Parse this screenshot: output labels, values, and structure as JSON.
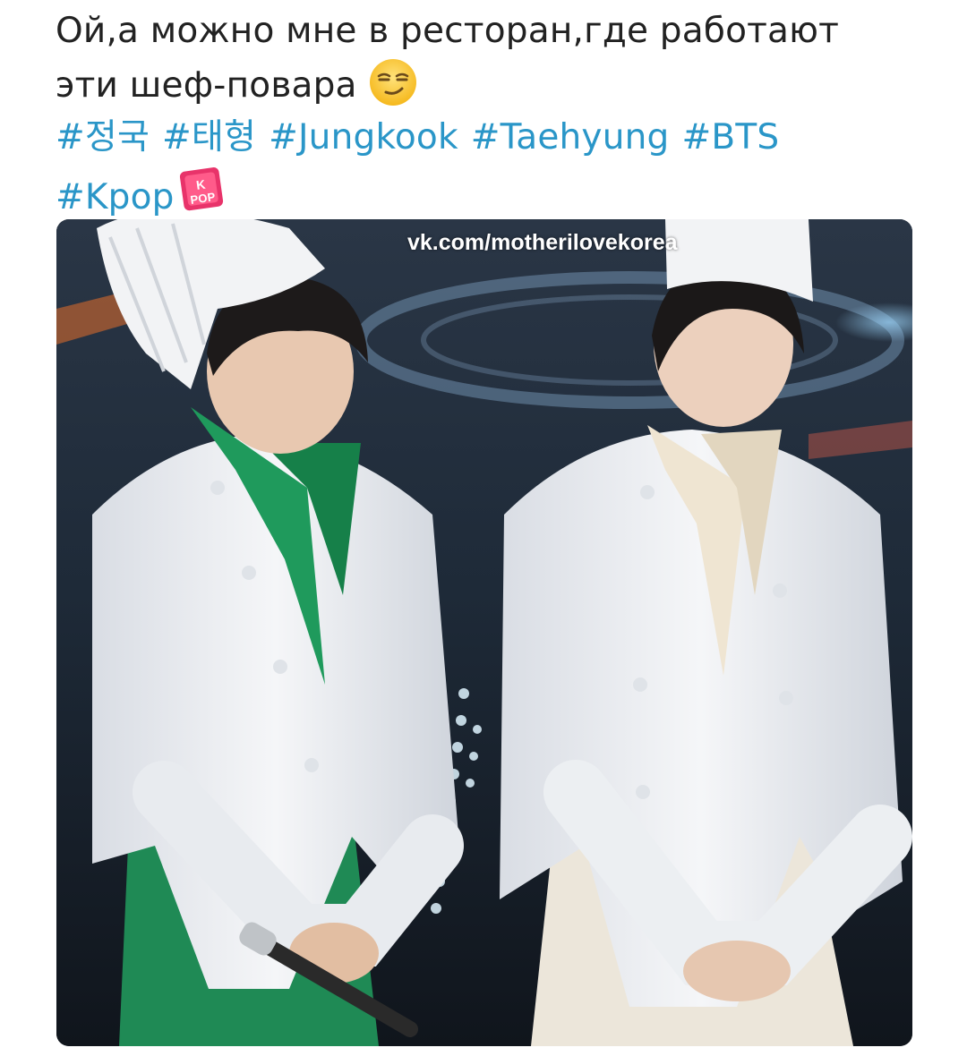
{
  "post": {
    "text_line1": "Ой,а можно мне в ресторан,где работают",
    "text_line2": "эти шеф-повара",
    "emoji": "smirking-face-icon",
    "hashtags_row1": [
      "#정국",
      "#태형",
      "#Jungkook",
      "#Taehyung",
      "#BTS"
    ],
    "hashtags_row2": [
      "#Kpop"
    ],
    "kpop_badge": "kpop-badge-icon",
    "badge_text_top": "K",
    "badge_text_bottom": "POP"
  },
  "photo": {
    "watermark": "vk.com/motherilovekorea",
    "description_icon": "photo-of-two-chefs"
  },
  "colors": {
    "text": "#222222",
    "hashtag": "#2a96c8",
    "background": "#ffffff"
  }
}
